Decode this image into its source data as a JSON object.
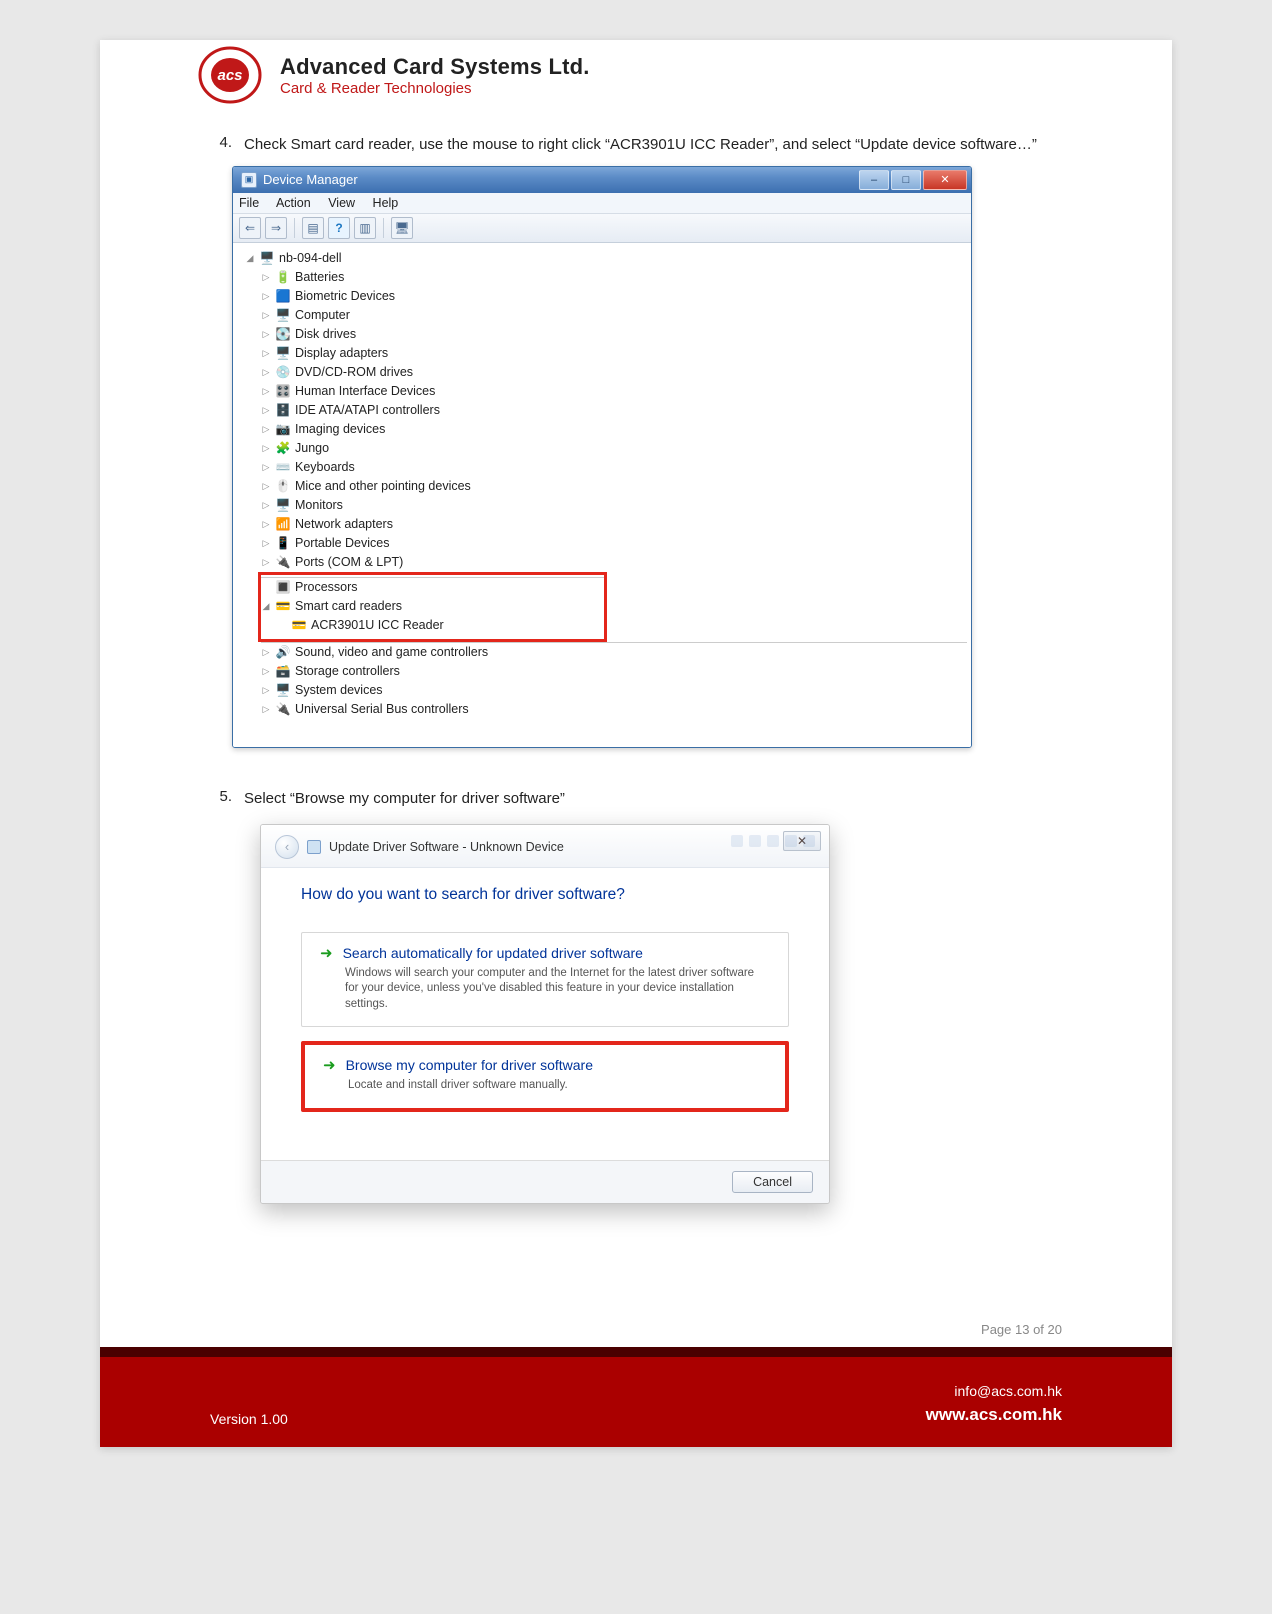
{
  "header": {
    "company": "Advanced Card Systems Ltd.",
    "tagline": "Card & Reader Technologies",
    "logo_text": "acs"
  },
  "steps": {
    "s4": {
      "num": "4.",
      "text": "Check Smart card reader, use the mouse to right click “ACR3901U ICC Reader”, and select “Update device software…”"
    },
    "s5": {
      "num": "5.",
      "text": "Select “Browse my computer for driver software”"
    }
  },
  "devmgr": {
    "title": "Device Manager",
    "menu": {
      "file": "File",
      "action": "Action",
      "view": "View",
      "help": "Help"
    },
    "root": "nb-094-dell",
    "nodes": [
      "Batteries",
      "Biometric Devices",
      "Computer",
      "Disk drives",
      "Display adapters",
      "DVD/CD-ROM drives",
      "Human Interface Devices",
      "IDE ATA/ATAPI controllers",
      "Imaging devices",
      "Jungo",
      "Keyboards",
      "Mice and other pointing devices",
      "Monitors",
      "Network adapters",
      "Portable Devices",
      "Ports (COM & LPT)",
      "Processors"
    ],
    "smart_parent": "Smart card readers",
    "smart_child": "ACR3901U ICC Reader",
    "nodes_after": [
      "Sound, video and game controllers",
      "Storage controllers",
      "System devices",
      "Universal Serial Bus controllers"
    ]
  },
  "wizard": {
    "title": "Update Driver Software - Unknown Device",
    "heading": "How do you want to search for driver software?",
    "opt1": {
      "title": "Search automatically for updated driver software",
      "sub": "Windows will search your computer and the Internet for the latest driver software for your device, unless you've disabled this feature in your device installation settings."
    },
    "opt2": {
      "title": "Browse my computer for driver software",
      "sub": "Locate and install driver software manually."
    },
    "cancel": "Cancel"
  },
  "footer": {
    "page": "Page 13 of 20",
    "version": "Version 1.00",
    "email": "info@acs.com.hk",
    "site": "www.acs.com.hk"
  },
  "glyphs": {
    "tri_closed": "▷",
    "tri_open": "◢",
    "arrow_back": "‹",
    "arrow_right": "➜",
    "min": "–",
    "max": "□",
    "x": "✕",
    "help": "?"
  }
}
